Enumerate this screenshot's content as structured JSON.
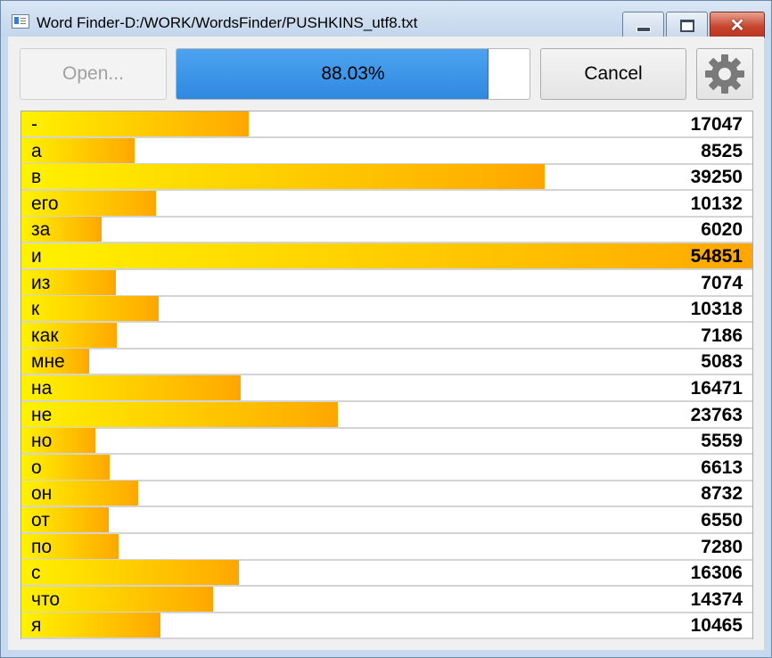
{
  "window": {
    "title": "Word Finder-D:/WORK/WordsFinder/PUSHKINS_utf8.txt"
  },
  "toolbar": {
    "open_label": "Open...",
    "progress_text": "88.03%",
    "progress_value": 0.8803,
    "cancel_label": "Cancel",
    "settings_icon": "gear-icon"
  },
  "colors": {
    "progress": "#2f89e0",
    "bar_start": "#fff200",
    "bar_end": "#ffa500"
  },
  "max_count": 54851,
  "words": [
    {
      "word": "-",
      "count": 17047
    },
    {
      "word": "а",
      "count": 8525
    },
    {
      "word": "в",
      "count": 39250
    },
    {
      "word": "его",
      "count": 10132
    },
    {
      "word": "за",
      "count": 6020
    },
    {
      "word": "и",
      "count": 54851
    },
    {
      "word": "из",
      "count": 7074
    },
    {
      "word": "к",
      "count": 10318
    },
    {
      "word": "как",
      "count": 7186
    },
    {
      "word": "мне",
      "count": 5083
    },
    {
      "word": "на",
      "count": 16471
    },
    {
      "word": "не",
      "count": 23763
    },
    {
      "word": "но",
      "count": 5559
    },
    {
      "word": "о",
      "count": 6613
    },
    {
      "word": "он",
      "count": 8732
    },
    {
      "word": "от",
      "count": 6550
    },
    {
      "word": "по",
      "count": 7280
    },
    {
      "word": "с",
      "count": 16306
    },
    {
      "word": "что",
      "count": 14374
    },
    {
      "word": "я",
      "count": 10465
    }
  ]
}
